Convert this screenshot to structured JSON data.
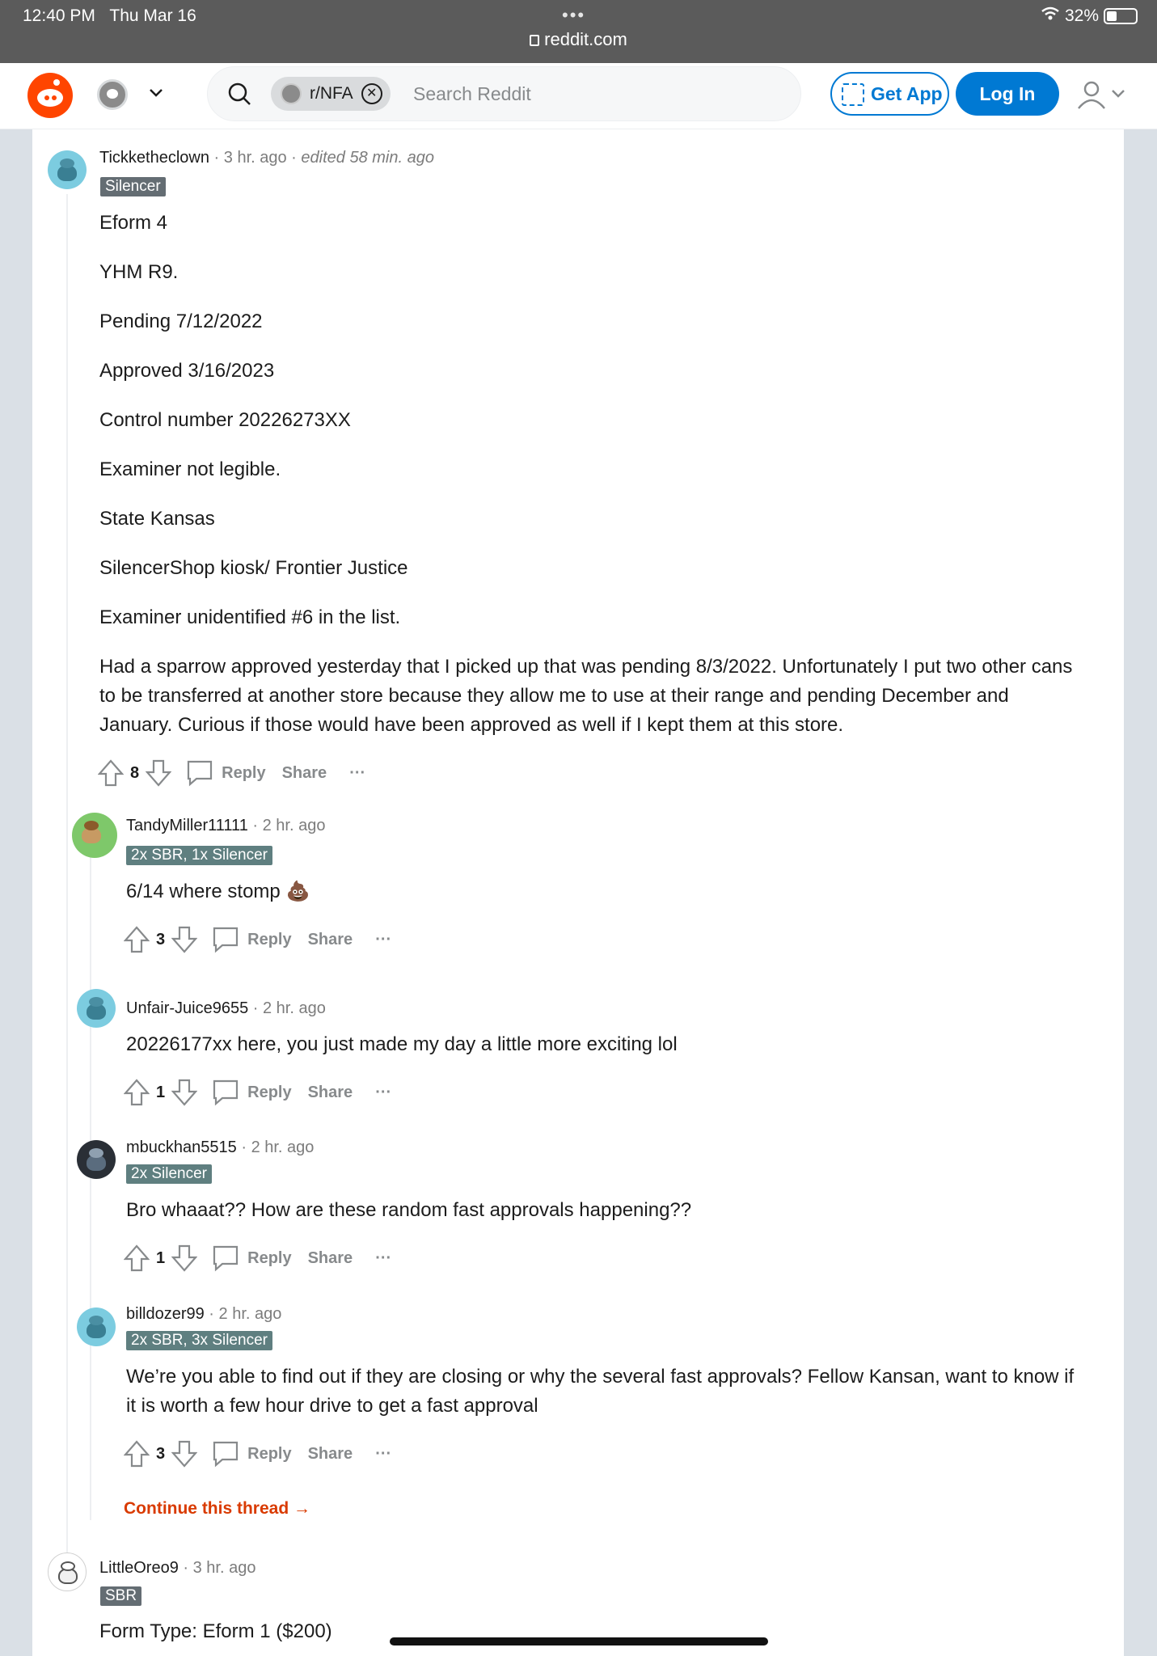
{
  "status_bar": {
    "time": "12:40 PM",
    "date": "Thu Mar 16",
    "url": "reddit.com",
    "battery": "32%"
  },
  "header": {
    "community_chip": "r/NFA",
    "search_placeholder": "Search Reddit",
    "get_app_label": "Get App",
    "login_label": "Log In"
  },
  "actions_labels": {
    "reply": "Reply",
    "share": "Share",
    "more": "···"
  },
  "comments": [
    {
      "user": "Tickketheclown",
      "time": "3 hr. ago",
      "edited": "edited 58 min. ago",
      "flair": "Silencer",
      "paragraphs": [
        "Eform 4",
        "YHM R9.",
        "Pending 7/12/2022",
        "Approved 3/16/2023",
        "Control number 20226273XX",
        "Examiner not legible.",
        "State Kansas",
        "SilencerShop kiosk/ Frontier Justice",
        "Examiner unidentified #6 in the list.",
        "Had a sparrow approved yesterday that I picked up that was pending 8/3/2022. Unfortunately I put two other cans to be transferred at another store because they allow me to use at their range and pending December and January. Curious if those would have been approved as well if I kept them at this store."
      ],
      "score": "8"
    },
    {
      "user": "TandyMiller11111",
      "time": "2 hr. ago",
      "flair": "2x SBR, 1x Silencer",
      "text": "6/14 where stomp 💩",
      "score": "3"
    },
    {
      "user": "Unfair-Juice9655",
      "time": "2 hr. ago",
      "text": "20226177xx here, you just made my day a little more exciting lol",
      "score": "1"
    },
    {
      "user": "mbuckhan5515",
      "time": "2 hr. ago",
      "flair": "2x Silencer",
      "text": "Bro whaaat?? How are these random fast approvals happening??",
      "score": "1"
    },
    {
      "user": "billdozer99",
      "time": "2 hr. ago",
      "flair": "2x SBR, 3x Silencer",
      "text": "We’re you able to find out if they are closing or why the several fast approvals? Fellow Kansan, want to know if it is worth a few hour drive to get a fast approval",
      "score": "3"
    },
    {
      "user": "LittleOreo9",
      "time": "3 hr. ago",
      "flair": "SBR",
      "text": "Form Type: Eform 1 ($200)"
    }
  ],
  "continue_thread": "Continue this thread →",
  "colors": {
    "reddit_orange": "#ff4500",
    "blue": "#0079d3",
    "link_red": "#d93a00"
  }
}
